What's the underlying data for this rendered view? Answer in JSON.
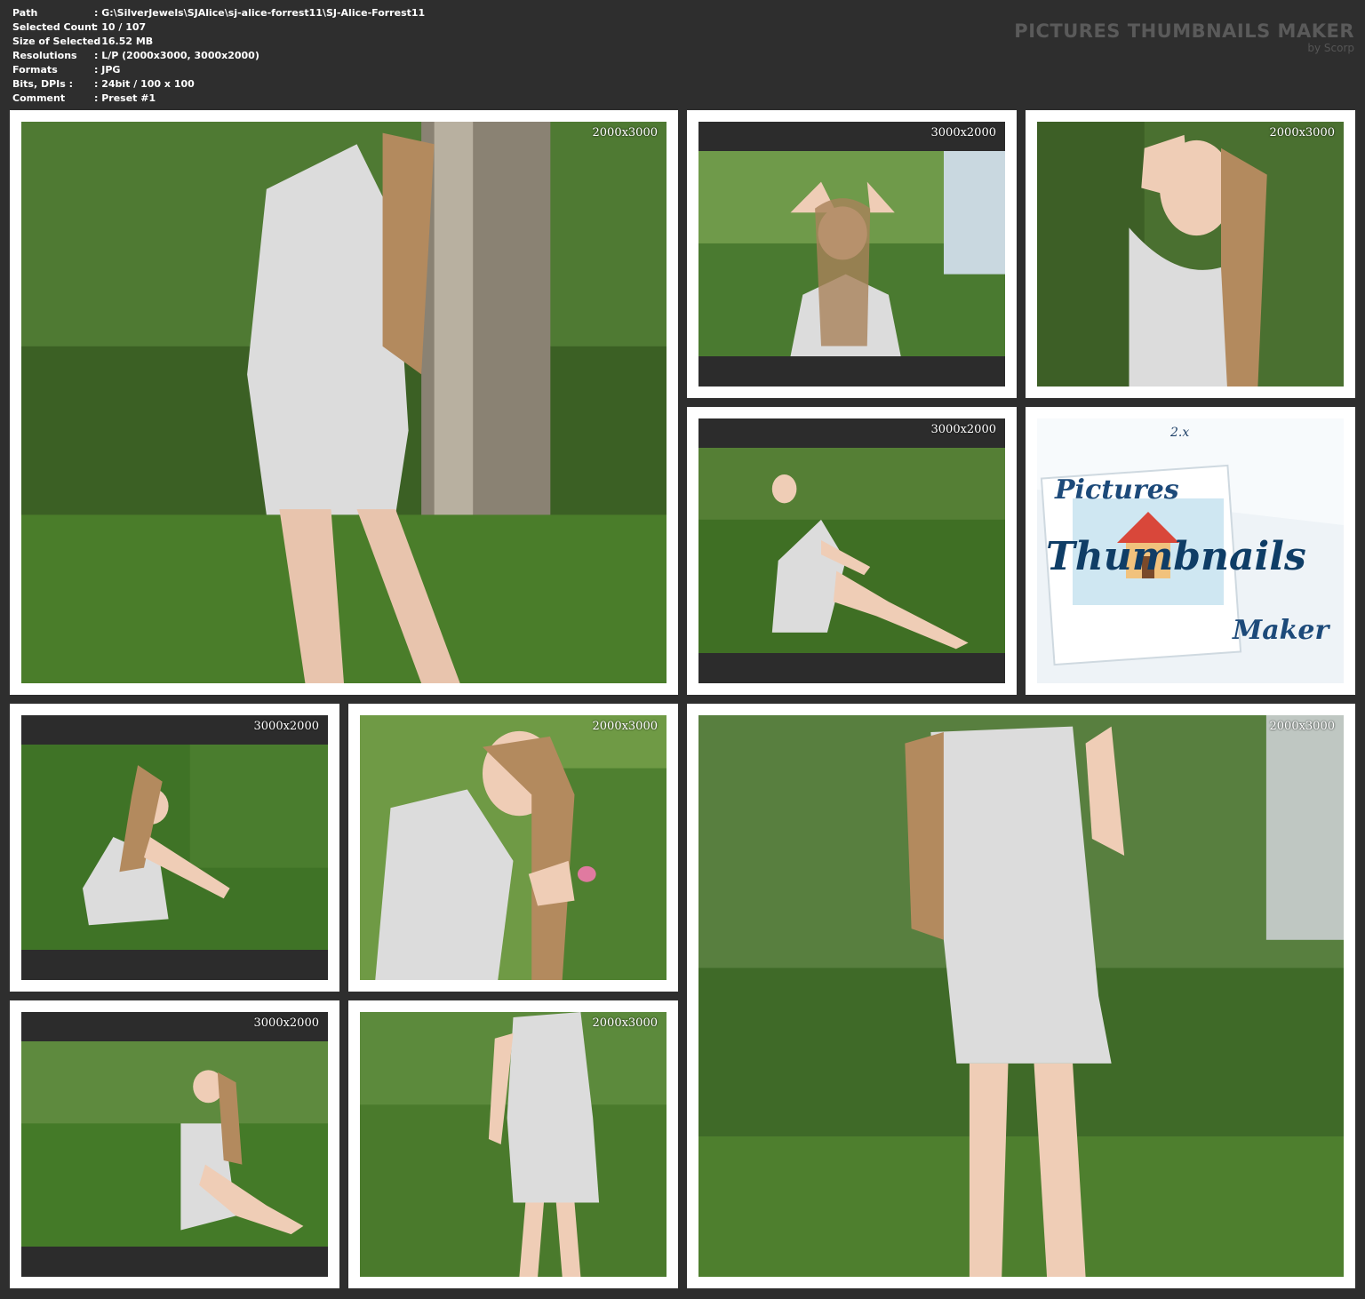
{
  "info": [
    {
      "label": "Path",
      "value": ": G:\\SilverJewels\\SJAlice\\sj-alice-forrest11\\SJ-Alice-Forrest11"
    },
    {
      "label": "Selected Count",
      "value": ": 10 / 107"
    },
    {
      "label": "Size of Selected",
      "value": ": 16.52 MB"
    },
    {
      "label": "Resolutions",
      "value": ": L/P (2000x3000, 3000x2000)"
    },
    {
      "label": "Formats",
      "value": ": JPG"
    },
    {
      "label": "Bits, DPIs :",
      "value": ": 24bit / 100 x 100"
    },
    {
      "label": "Comment",
      "value": ": Preset #1"
    }
  ],
  "brand": {
    "title": "PICTURES THUMBNAILS MAKER",
    "subtitle": "by Scorp"
  },
  "thumbs": [
    {
      "res": "2000x3000",
      "orientation": "portrait"
    },
    {
      "res": "3000x2000",
      "orientation": "landscape"
    },
    {
      "res": "2000x3000",
      "orientation": "portrait"
    },
    {
      "res": "3000x2000",
      "orientation": "landscape"
    },
    {
      "res": "",
      "orientation": "logo"
    },
    {
      "res": "3000x2000",
      "orientation": "landscape"
    },
    {
      "res": "2000x3000",
      "orientation": "portrait"
    },
    {
      "res": "2000x3000",
      "orientation": "portrait"
    },
    {
      "res": "3000x2000",
      "orientation": "landscape"
    },
    {
      "res": "2000x3000",
      "orientation": "portrait"
    }
  ],
  "logo": {
    "word1": "Pictures",
    "word2": "Thumbnails",
    "word3": "Maker",
    "version": "2.x"
  },
  "colors": {
    "background": "#2e2e2e",
    "tile": "#ffffff",
    "grass": "#3f6a24",
    "dress": "#d9d9d9"
  }
}
